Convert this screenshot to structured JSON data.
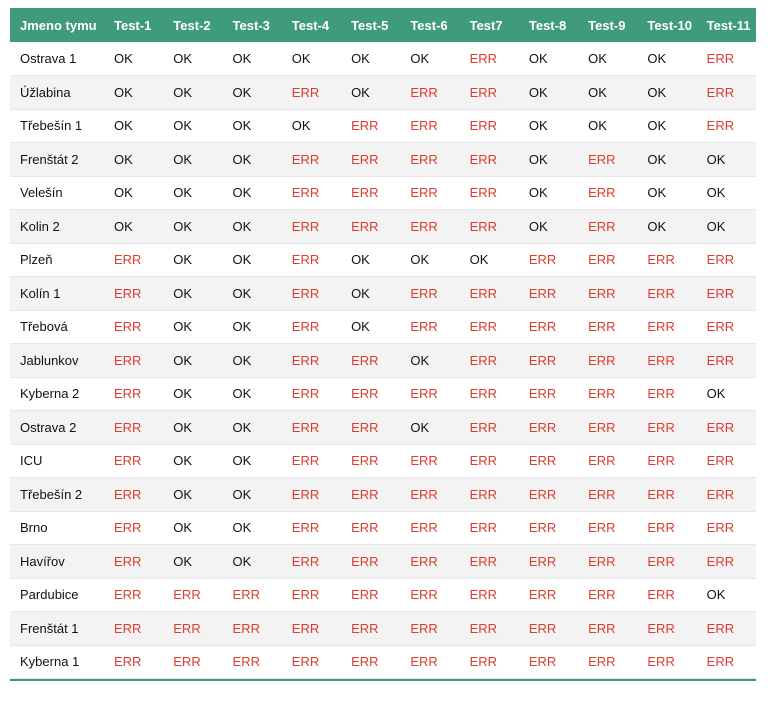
{
  "colors": {
    "header_bg": "#3f9b7a",
    "err": "#dd3c2f",
    "ok": "#111111",
    "stripe": "#f3f3f3"
  },
  "table": {
    "headers": [
      "Jmeno tymu",
      "Test-1",
      "Test-2",
      "Test-3",
      "Test-4",
      "Test-5",
      "Test-6",
      "Test7",
      "Test-8",
      "Test-9",
      "Test-10",
      "Test-11"
    ],
    "rows": [
      {
        "team": "Ostrava 1",
        "results": [
          "OK",
          "OK",
          "OK",
          "OK",
          "OK",
          "OK",
          "ERR",
          "OK",
          "OK",
          "OK",
          "ERR"
        ]
      },
      {
        "team": "Úžlabina",
        "results": [
          "OK",
          "OK",
          "OK",
          "ERR",
          "OK",
          "ERR",
          "ERR",
          "OK",
          "OK",
          "OK",
          "ERR"
        ]
      },
      {
        "team": "Třebešín 1",
        "results": [
          "OK",
          "OK",
          "OK",
          "OK",
          "ERR",
          "ERR",
          "ERR",
          "OK",
          "OK",
          "OK",
          "ERR"
        ]
      },
      {
        "team": "Frenštát 2",
        "results": [
          "OK",
          "OK",
          "OK",
          "ERR",
          "ERR",
          "ERR",
          "ERR",
          "OK",
          "ERR",
          "OK",
          "OK"
        ]
      },
      {
        "team": "Velešín",
        "results": [
          "OK",
          "OK",
          "OK",
          "ERR",
          "ERR",
          "ERR",
          "ERR",
          "OK",
          "ERR",
          "OK",
          "OK"
        ]
      },
      {
        "team": "Kolin 2",
        "results": [
          "OK",
          "OK",
          "OK",
          "ERR",
          "ERR",
          "ERR",
          "ERR",
          "OK",
          "ERR",
          "OK",
          "OK"
        ]
      },
      {
        "team": "Plzeň",
        "results": [
          "ERR",
          "OK",
          "OK",
          "ERR",
          "OK",
          "OK",
          "OK",
          "ERR",
          "ERR",
          "ERR",
          "ERR"
        ]
      },
      {
        "team": "Kolín 1",
        "results": [
          "ERR",
          "OK",
          "OK",
          "ERR",
          "OK",
          "ERR",
          "ERR",
          "ERR",
          "ERR",
          "ERR",
          "ERR"
        ]
      },
      {
        "team": "Třebová",
        "results": [
          "ERR",
          "OK",
          "OK",
          "ERR",
          "OK",
          "ERR",
          "ERR",
          "ERR",
          "ERR",
          "ERR",
          "ERR"
        ]
      },
      {
        "team": "Jablunkov",
        "results": [
          "ERR",
          "OK",
          "OK",
          "ERR",
          "ERR",
          "OK",
          "ERR",
          "ERR",
          "ERR",
          "ERR",
          "ERR"
        ]
      },
      {
        "team": "Kyberna 2",
        "results": [
          "ERR",
          "OK",
          "OK",
          "ERR",
          "ERR",
          "ERR",
          "ERR",
          "ERR",
          "ERR",
          "ERR",
          "OK"
        ]
      },
      {
        "team": "Ostrava 2",
        "results": [
          "ERR",
          "OK",
          "OK",
          "ERR",
          "ERR",
          "OK",
          "ERR",
          "ERR",
          "ERR",
          "ERR",
          "ERR"
        ]
      },
      {
        "team": "ICU",
        "results": [
          "ERR",
          "OK",
          "OK",
          "ERR",
          "ERR",
          "ERR",
          "ERR",
          "ERR",
          "ERR",
          "ERR",
          "ERR"
        ]
      },
      {
        "team": "Třebešín 2",
        "results": [
          "ERR",
          "OK",
          "OK",
          "ERR",
          "ERR",
          "ERR",
          "ERR",
          "ERR",
          "ERR",
          "ERR",
          "ERR"
        ]
      },
      {
        "team": "Brno",
        "results": [
          "ERR",
          "OK",
          "OK",
          "ERR",
          "ERR",
          "ERR",
          "ERR",
          "ERR",
          "ERR",
          "ERR",
          "ERR"
        ]
      },
      {
        "team": "Havířov",
        "results": [
          "ERR",
          "OK",
          "OK",
          "ERR",
          "ERR",
          "ERR",
          "ERR",
          "ERR",
          "ERR",
          "ERR",
          "ERR"
        ]
      },
      {
        "team": "Pardubice",
        "results": [
          "ERR",
          "ERR",
          "ERR",
          "ERR",
          "ERR",
          "ERR",
          "ERR",
          "ERR",
          "ERR",
          "ERR",
          "OK"
        ]
      },
      {
        "team": "Frenštát 1",
        "results": [
          "ERR",
          "ERR",
          "ERR",
          "ERR",
          "ERR",
          "ERR",
          "ERR",
          "ERR",
          "ERR",
          "ERR",
          "ERR"
        ]
      },
      {
        "team": "Kyberna 1",
        "results": [
          "ERR",
          "ERR",
          "ERR",
          "ERR",
          "ERR",
          "ERR",
          "ERR",
          "ERR",
          "ERR",
          "ERR",
          "ERR"
        ]
      }
    ]
  }
}
